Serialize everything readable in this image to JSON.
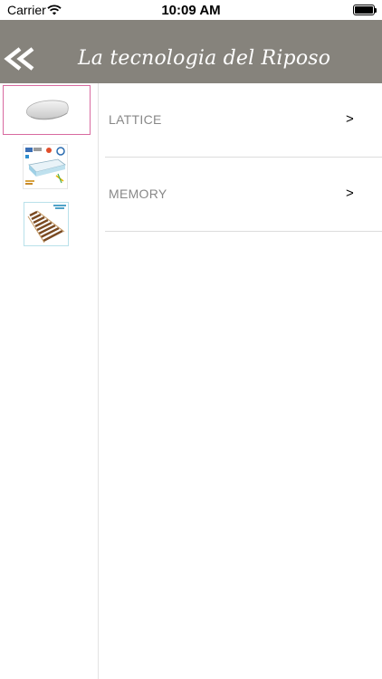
{
  "status_bar": {
    "carrier": "Carrier",
    "time": "10:09 AM"
  },
  "header": {
    "title": "La tecnologia del Riposo",
    "back_icon": "double-chevron-left-icon",
    "background": "#86837c"
  },
  "sidebar": {
    "items": [
      {
        "name": "pillow-thumbnail",
        "selected": true
      },
      {
        "name": "mattress-thumbnail",
        "selected": false
      },
      {
        "name": "slatted-base-thumbnail",
        "selected": false
      }
    ],
    "selected_border_color": "#d86aa0"
  },
  "list": {
    "items": [
      {
        "label": "LATTICE",
        "chevron": ">"
      },
      {
        "label": "MEMORY",
        "chevron": ">"
      }
    ]
  }
}
